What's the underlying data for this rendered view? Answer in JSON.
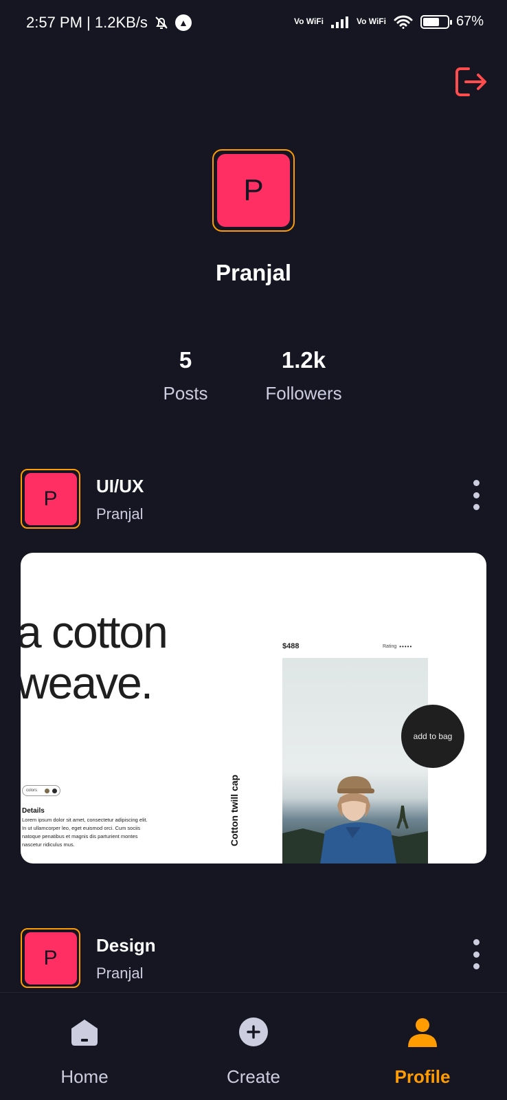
{
  "status_bar": {
    "time_speed": "2:57 PM | 1.2KB/s",
    "vowifi_1": "Vo WiFi",
    "vowifi_2": "Vo WiFi",
    "battery": "67%",
    "battery_level": 0.67,
    "icons": [
      "bell-off-icon",
      "a-circle-icon",
      "signal-icon",
      "wifi-icon",
      "battery-icon"
    ]
  },
  "header": {
    "logout_icon": "logout-icon"
  },
  "profile": {
    "initial": "P",
    "name": "Pranjal",
    "stats": [
      {
        "value": "5",
        "label": "Posts"
      },
      {
        "value": "1.2k",
        "label": "Followers"
      }
    ]
  },
  "posts": [
    {
      "avatar_initial": "P",
      "title": "UI/UX",
      "author": "Pranjal",
      "thumbnail": {
        "headline_1": "a cotton",
        "headline_2": "weave.",
        "price": "$488",
        "rating_label": "Rating",
        "rating_stars": "•••••",
        "cart_button": "add to bag",
        "vertical_title": "Cotton twill cap",
        "colors_label": "colors",
        "details_title": "Details",
        "details_text": "Lorem ipsum dolor sit amet, consectetur adipiscing elit. In ut ullamcorper leo, eget euismod orci. Cum sociis natoque penatibus et magnis dis parturient montes nascetur ridiculus mus."
      }
    },
    {
      "avatar_initial": "P",
      "title": "Design",
      "author": "Pranjal"
    }
  ],
  "bottom_nav": [
    {
      "label": "Home",
      "icon": "home-icon",
      "active": false
    },
    {
      "label": "Create",
      "icon": "plus-icon",
      "active": false
    },
    {
      "label": "Profile",
      "icon": "profile-icon",
      "active": true
    }
  ],
  "colors": {
    "background": "#161622",
    "accent": "#ff9c01",
    "avatar": "#ff2f63",
    "logout": "#ff4d4d",
    "muted_text": "#cdcde0"
  }
}
